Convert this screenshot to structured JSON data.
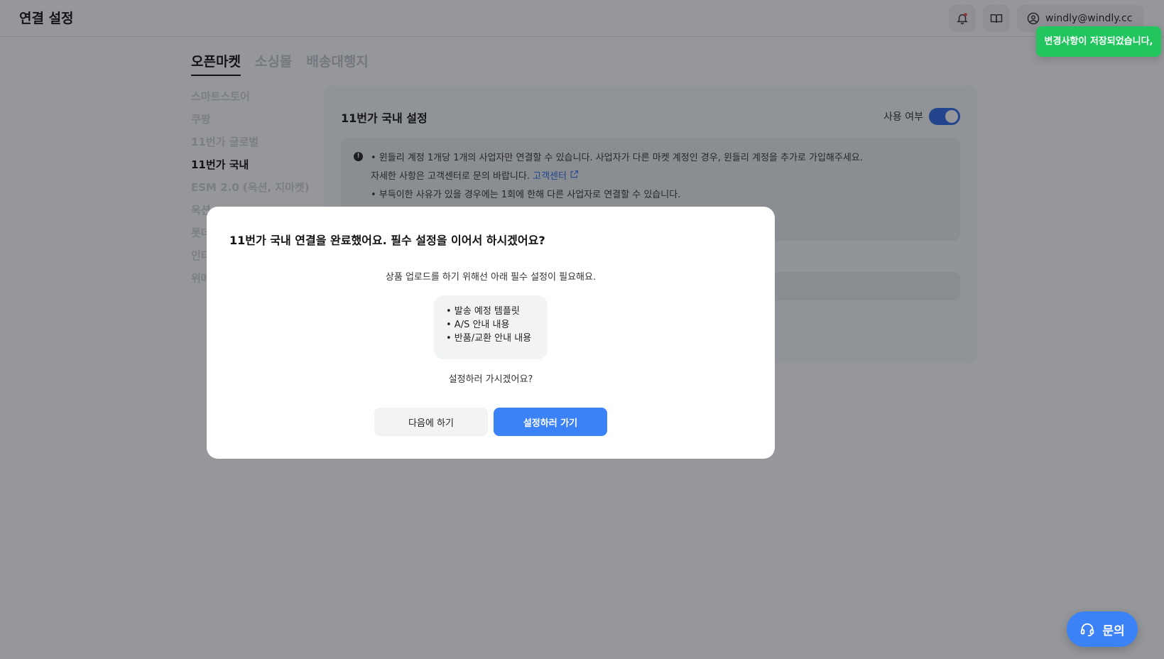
{
  "header": {
    "title": "연결 설정",
    "user_email": "windly@windly.cc",
    "icons": {
      "bell": "bell-icon",
      "book": "book-icon",
      "user": "user-circle-icon"
    }
  },
  "tabs": [
    {
      "label": "오픈마켓",
      "active": true
    },
    {
      "label": "소싱몰",
      "active": false
    },
    {
      "label": "배송대행지",
      "active": false
    }
  ],
  "sidenav": {
    "items": [
      {
        "label": "스마트스토어",
        "active": false
      },
      {
        "label": "쿠팡",
        "active": false
      },
      {
        "label": "11번가 글로벌",
        "active": false
      },
      {
        "label": "11번가 국내",
        "active": true
      },
      {
        "label": "ESM 2.0 (옥션, 지마켓)",
        "active": false
      },
      {
        "label": "옥션",
        "active": false
      },
      {
        "label": "롯데",
        "active": false
      },
      {
        "label": "인터",
        "active": false
      },
      {
        "label": "위메",
        "active": false
      }
    ]
  },
  "card": {
    "title": "11번가 국내 설정",
    "toggle_label": "사용 여부",
    "toggle_on": true,
    "notice": {
      "line1": "• 윈들리 계정 1개당 1개의 사업자만 연결할 수 있습니다. 사업자가 다른 마켓 계정인 경우, 윈들리 계정을 추가로 가입해주세요.",
      "line2": "자세한 사항은 고객센터로 문의 바랍니다.",
      "link": "고객센터",
      "line3": "• 부득이한 사유가 있을 경우에는 1회에 한해 다른 사업자로 연결할 수 있습니다."
    }
  },
  "modal": {
    "title": "11번가 국내 연결을 완료했어요. 필수 설정을 이어서 하시겠어요?",
    "description": "상품 업로드를 하기 위해선 아래 필수 설정이 필요해요.",
    "requirements": [
      "• 발송 예정 템플릿",
      "• A/S 안내 내용",
      "• 반품/교환 안내 내용"
    ],
    "question": "설정하러 가시겠어요?",
    "later_label": "다음에 하기",
    "go_label": "설정하러 가기"
  },
  "toast": {
    "message": "변경사항이 저장되었습니다,"
  },
  "chat": {
    "label": "문의",
    "icon": "headset-icon"
  },
  "colors": {
    "accent": "#3b82f6",
    "toast": "#22c55e",
    "toggle": "#2f6bea"
  }
}
